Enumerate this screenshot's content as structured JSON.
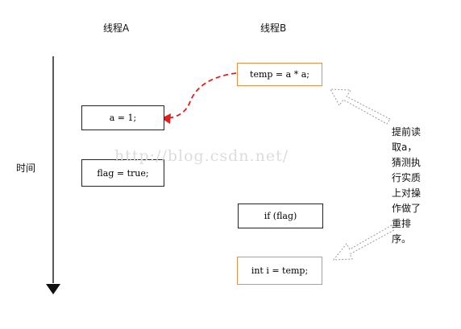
{
  "columns": {
    "thread_a": "线程A",
    "thread_b": "线程B"
  },
  "axis": {
    "time_label": "时间"
  },
  "thread_a_boxes": {
    "assign_a": "a = 1;",
    "assign_flag": "flag = true;"
  },
  "thread_b_boxes": {
    "temp": "temp = a * a;",
    "if_flag": "if (flag)",
    "int_i": "int i = temp;"
  },
  "annotation": {
    "lines": [
      "提前读",
      "取a，",
      "猜测执",
      "行实质",
      "上对操",
      "作做了",
      "重排",
      "序。"
    ]
  },
  "watermark": "http://blog.csdn.net/",
  "colors": {
    "orange_border": "#e6914a",
    "red_arrow": "#e0201e"
  }
}
